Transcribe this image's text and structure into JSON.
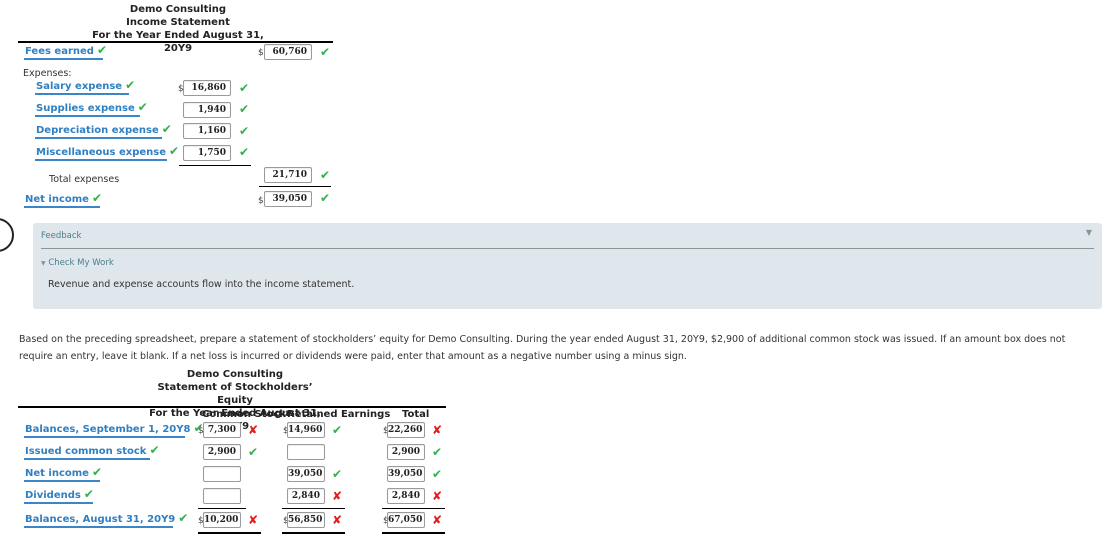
{
  "income_statement": {
    "company": "Demo Consulting",
    "title": "Income Statement",
    "period": "For the Year Ended August 31, 20Y9",
    "fees_earned": {
      "label": "Fees earned",
      "value": "60,760",
      "status": "correct"
    },
    "expenses_label": "Expenses:",
    "expenses": [
      {
        "label": "Salary expense",
        "value": "16,860",
        "status": "correct"
      },
      {
        "label": "Supplies expense",
        "value": "1,940",
        "status": "correct"
      },
      {
        "label": "Depreciation expense",
        "value": "1,160",
        "status": "correct"
      },
      {
        "label": "Miscellaneous expense",
        "value": "1,750",
        "status": "correct"
      }
    ],
    "total_expenses": {
      "label": "Total expenses",
      "value": "21,710",
      "status": "correct"
    },
    "net_income": {
      "label": "Net income",
      "value": "39,050",
      "status": "correct"
    }
  },
  "feedback": {
    "title": "Feedback",
    "toggle": "Check My Work",
    "message": "Revenue and expense accounts flow into the income statement."
  },
  "instructions": "Based on the preceding spreadsheet, prepare a statement of stockholders’ equity for Demo Consulting. During the year ended August 31, 20Y9, $2,900 of additional common stock was issued. If an amount box does not require an entry, leave it blank. If a net loss is incurred or dividends were paid, enter that amount as a negative number using a minus sign.",
  "equity_statement": {
    "company": "Demo Consulting",
    "title": "Statement of Stockholders’ Equity",
    "period": "For the Year Ended August 31, 20Y9",
    "columns": [
      "Common Stock",
      "Retained Earnings",
      "Total"
    ],
    "rows": [
      {
        "label": "Balances, September 1, 20Y8",
        "common_stock": "7,300",
        "cs_status": "incorrect",
        "retained_earnings": "14,960",
        "re_status": "correct",
        "total": "22,260",
        "total_status": "incorrect"
      },
      {
        "label": "Issued common stock",
        "common_stock": "2,900",
        "cs_status": "correct",
        "retained_earnings": "",
        "re_status": "",
        "total": "2,900",
        "total_status": "correct"
      },
      {
        "label": "Net income",
        "common_stock": "",
        "cs_status": "",
        "retained_earnings": "39,050",
        "re_status": "correct",
        "total": "39,050",
        "total_status": "correct"
      },
      {
        "label": "Dividends",
        "common_stock": "",
        "cs_status": "",
        "retained_earnings": "2,840",
        "re_status": "incorrect",
        "total": "2,840",
        "total_status": "incorrect"
      },
      {
        "label": "Balances, August 31, 20Y9",
        "common_stock": "10,200",
        "cs_status": "incorrect",
        "retained_earnings": "56,850",
        "re_status": "incorrect",
        "total": "67,050",
        "total_status": "incorrect"
      }
    ]
  },
  "icons": {
    "correct": "✔",
    "incorrect": "✘",
    "collapse": "▼"
  },
  "colors": {
    "correct": "#2db34a",
    "incorrect": "#e11b1b",
    "link": "#2f7fc1",
    "feedback_bg": "#dfe6ec"
  }
}
